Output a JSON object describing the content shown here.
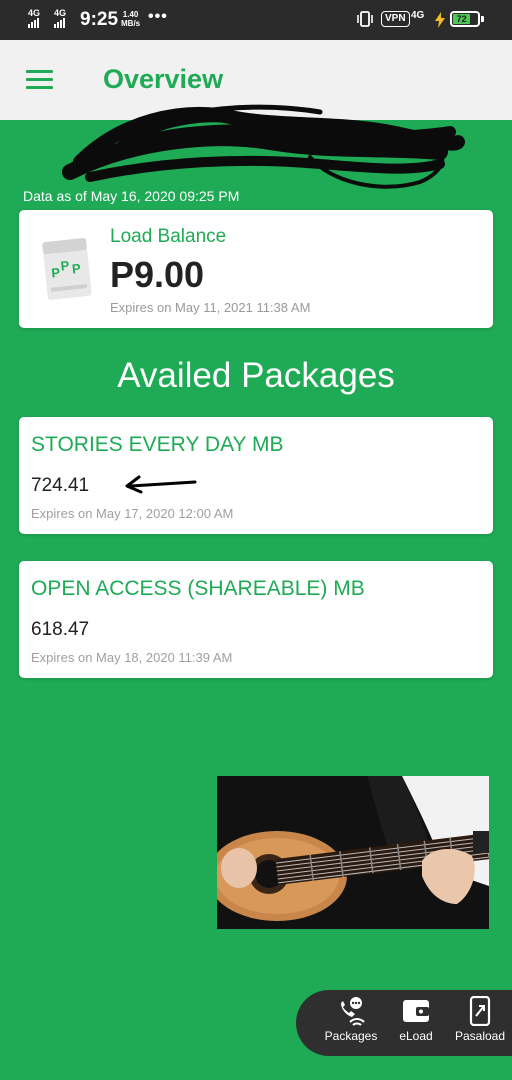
{
  "status_bar": {
    "sim1": "4G",
    "sim2": "4G",
    "time": "9:25",
    "speed_value": "1.40",
    "speed_unit": "MB/s",
    "more": "•••",
    "vpn": "VPN",
    "network": "4G",
    "battery": "72"
  },
  "app_bar": {
    "title": "Overview",
    "menu_icon": "hamburger-menu-icon"
  },
  "account": {
    "data_as_of": "Data as of May 16, 2020 09:25 PM"
  },
  "load_balance": {
    "label": "Load Balance",
    "value": "P9.00",
    "expiry": "Expires on May 11, 2021 11:38 AM",
    "icon": "load-wallet-icon"
  },
  "packages": {
    "title": "Availed Packages",
    "items": [
      {
        "name": "STORIES EVERY DAY MB",
        "amount": "724.41",
        "expiry": "Expires on May 17, 2020 12:00 AM"
      },
      {
        "name": "OPEN ACCESS (SHAREABLE) MB",
        "amount": "618.47",
        "expiry": "Expires on May 18, 2020 11:39 AM"
      }
    ]
  },
  "bottom_nav": {
    "items": [
      {
        "label": "Packages",
        "icon": "packages-wifi-icon"
      },
      {
        "label": "eLoad",
        "icon": "wallet-icon"
      },
      {
        "label": "Pasaload",
        "icon": "phone-share-icon"
      }
    ]
  },
  "colors": {
    "primary_green": "#1faa55",
    "status_bar": "#2b2b2b",
    "card": "#ffffff",
    "nav_bg": "#2f2f2f"
  }
}
